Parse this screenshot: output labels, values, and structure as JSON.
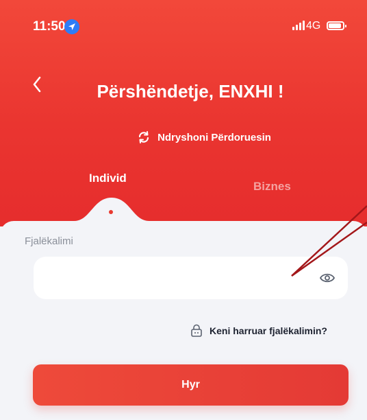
{
  "status_bar": {
    "time": "11:50",
    "network": "4G",
    "location_icon": "location-arrow-icon",
    "signal_icon": "signal-bars-icon",
    "battery_icon": "battery-icon"
  },
  "header": {
    "back_icon": "chevron-left-icon",
    "greeting": "Përshëndetje, ENXHI !",
    "switch_user_label": "Ndryshoni Përdoruesin",
    "switch_user_icon": "refresh-icon"
  },
  "tabs": [
    {
      "label": "Individ",
      "active": true
    },
    {
      "label": "Biznes",
      "active": false
    }
  ],
  "form": {
    "password_label": "Fjalëkalimi",
    "password_value": "",
    "password_placeholder": "",
    "eye_icon": "eye-icon",
    "forgot_label": "Keni harruar fjalëkalimin?",
    "forgot_icon": "lock-icon",
    "login_label": "Hyr"
  },
  "colors": {
    "brand_red": "#e8392f",
    "panel_bg": "#f3f4f8",
    "annotation": "#a3171a"
  }
}
